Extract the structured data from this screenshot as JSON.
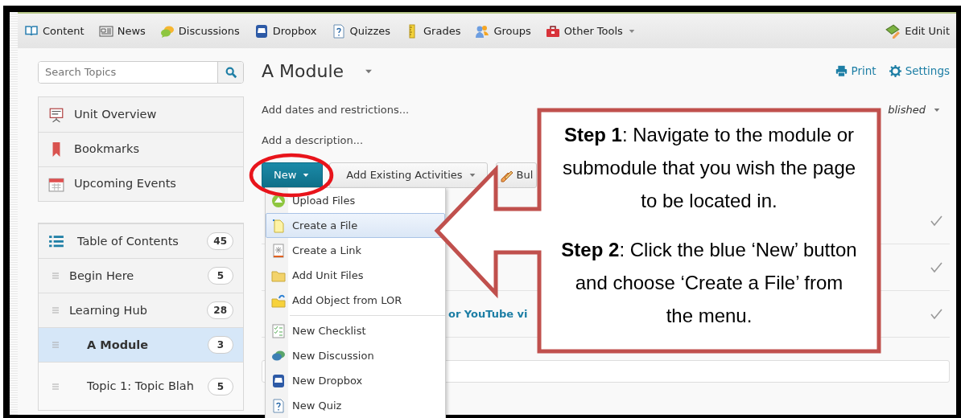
{
  "toolbar": {
    "items": [
      {
        "kind": "book",
        "label": "Content"
      },
      {
        "kind": "news",
        "label": "News"
      },
      {
        "kind": "chat",
        "label": "Discussions"
      },
      {
        "kind": "tray",
        "label": "Dropbox"
      },
      {
        "kind": "quiz",
        "label": "Quizzes"
      },
      {
        "kind": "ruler",
        "label": "Grades"
      },
      {
        "kind": "people",
        "label": "Groups"
      },
      {
        "kind": "toolbox",
        "label": "Other Tools",
        "dropdown": true
      }
    ],
    "edit_unit": "Edit Unit"
  },
  "sidebar": {
    "search": {
      "placeholder": "Search Topics"
    },
    "tools": [
      {
        "kind": "presentation",
        "label": "Unit Overview"
      },
      {
        "kind": "bookmark",
        "label": "Bookmarks"
      },
      {
        "kind": "calendar",
        "label": "Upcoming Events"
      }
    ],
    "table_of_contents": {
      "label": "Table of Contents",
      "count": "45"
    },
    "topics": [
      {
        "label": "Begin Here",
        "count": "5",
        "selected": false
      },
      {
        "label": "Learning Hub",
        "count": "28",
        "selected": false,
        "children": [
          {
            "label": "A Module",
            "count": "3",
            "selected": true
          },
          {
            "label": "Topic 1: Topic Blah",
            "count": "5",
            "selected": false
          }
        ]
      }
    ]
  },
  "main": {
    "title": "A Module",
    "print": "Print",
    "settings": "Settings",
    "add_dates": "Add dates and restrictions...",
    "add_description": "Add a description...",
    "status": "blished",
    "buttons": [
      {
        "kind": "primary",
        "label": "New"
      },
      {
        "kind": "dropdown",
        "label": "Add Existing Activities"
      },
      {
        "kind": "bulk",
        "label": "Bul"
      }
    ],
    "new_menu": {
      "groups": [
        [
          {
            "kind": "upload",
            "label": "Upload Files",
            "selected": false
          },
          {
            "kind": "file",
            "label": "Create a File",
            "selected": true
          },
          {
            "kind": "link",
            "label": "Create a Link",
            "selected": false
          },
          {
            "kind": "folder",
            "label": "Add Unit Files",
            "selected": false
          },
          {
            "kind": "lor",
            "label": "Add Object from LOR",
            "selected": false
          }
        ],
        [
          {
            "kind": "checklist",
            "label": "New Checklist",
            "selected": false
          },
          {
            "kind": "discussion",
            "label": "New Discussion",
            "selected": false
          },
          {
            "kind": "dropbox",
            "label": "New Dropbox",
            "selected": false
          },
          {
            "kind": "quiz",
            "label": "New Quiz",
            "selected": false
          }
        ]
      ]
    },
    "rows": [
      {
        "kind": "plain"
      },
      {
        "kind": "plain"
      },
      {
        "kind": "link",
        "text": "or YouTube vi"
      }
    ]
  },
  "annotations": [
    {
      "kind": "ellipse"
    },
    {
      "kind": "callout",
      "paragraphs": [
        "**Step 1**: Navigate to the module or submodule that you wish the page to be located in.",
        "**Step 2**: Click the blue ‘New’ button and choose ‘Create a File’ from the menu."
      ]
    }
  ]
}
